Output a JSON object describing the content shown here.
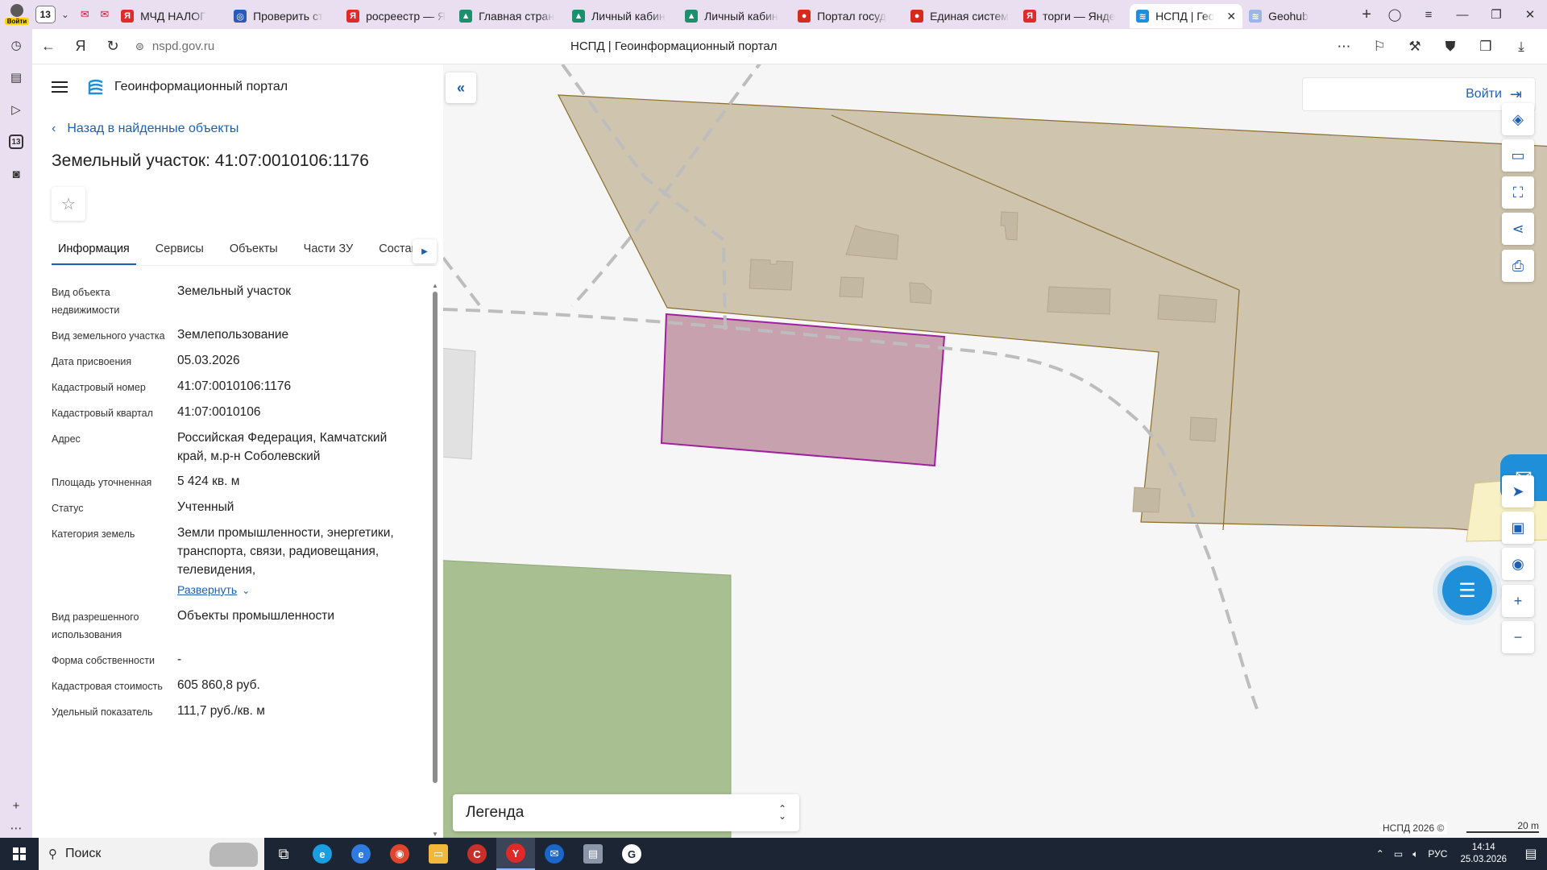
{
  "browser": {
    "profile_label": "Войти",
    "tab_count": "13",
    "tabs": [
      {
        "title": "МЧД НАЛОГ",
        "fav_color": "#e12a2a",
        "fav_char": "Я"
      },
      {
        "title": "Проверить ст",
        "fav_color": "#2b5ab8",
        "fav_char": "◎"
      },
      {
        "title": "росреестр — Я",
        "fav_color": "#e12a2a",
        "fav_char": "Я"
      },
      {
        "title": "Главная стран",
        "fav_color": "#1c8f6d",
        "fav_char": "▲"
      },
      {
        "title": "Личный кабин",
        "fav_color": "#1c8f6d",
        "fav_char": "▲"
      },
      {
        "title": "Личный кабин",
        "fav_color": "#1c8f6d",
        "fav_char": "▲"
      },
      {
        "title": "Портал госуд",
        "fav_color": "#d52b1e",
        "fav_char": "●"
      },
      {
        "title": "Единая систем",
        "fav_color": "#d52b1e",
        "fav_char": "●"
      },
      {
        "title": "торги — Янде",
        "fav_color": "#e12a2a",
        "fav_char": "Я"
      },
      {
        "title": "НСПД | Гео",
        "fav_color": "#1e8fd8",
        "fav_char": "≋",
        "active": true
      },
      {
        "title": "Geohub",
        "fav_color": "#9fb4e6",
        "fav_char": "≋"
      }
    ],
    "url": "nspd.gov.ru",
    "page_title": "НСПД | Геоинформационный портал"
  },
  "panel": {
    "portal_name": "Геоинформационный портал",
    "back_link": "Назад в найденные объекты",
    "object_title": "Земельный участок: 41:07:0010106:1176",
    "tabs": [
      "Информация",
      "Сервисы",
      "Объекты",
      "Части ЗУ",
      "Состав"
    ],
    "properties": [
      {
        "label": "Вид объекта недвижимости",
        "value": "Земельный участок"
      },
      {
        "label": "Вид земельного участка",
        "value": "Землепользование"
      },
      {
        "label": "Дата присвоения",
        "value": "05.03.2026"
      },
      {
        "label": "Кадастровый номер",
        "value": "41:07:0010106:1176"
      },
      {
        "label": "Кадастровый квартал",
        "value": "41:07:0010106"
      },
      {
        "label": "Адрес",
        "value": "Российская Федерация, Камчатский край, м.р-н Соболевский"
      },
      {
        "label": "Площадь уточненная",
        "value": "5 424 кв. м"
      },
      {
        "label": "Статус",
        "value": "Учтенный"
      },
      {
        "label": "Категория земель",
        "value": "Земли промышленности, энергетики, транспорта, связи, радиовещания, телевидения,",
        "expand": "Развернуть"
      },
      {
        "label": "Вид разрешенного использования",
        "value": "Объекты промышленности"
      },
      {
        "label": "Форма собственности",
        "value": "-"
      },
      {
        "label": "Кадастровая стоимость",
        "value": "605 860,8 руб."
      },
      {
        "label": "Удельный показатель",
        "value": "111,7 руб./кв. м"
      }
    ]
  },
  "map": {
    "login_label": "Войти",
    "legend_label": "Легенда",
    "copyright": "НСПД 2026 ©",
    "scale_label": "20 m",
    "colors": {
      "parcel_fill": "#cfc4ad",
      "parcel_stroke": "#8a6d2f",
      "selected_fill": "#c8a1ae",
      "selected_stroke": "#a020a0",
      "green_fill": "#a8bf92",
      "building_fill": "#c3b8a1"
    }
  },
  "taskbar": {
    "search_placeholder": "Поиск",
    "lang": "РУС",
    "time": "14:14",
    "date": "25.03.2026"
  }
}
